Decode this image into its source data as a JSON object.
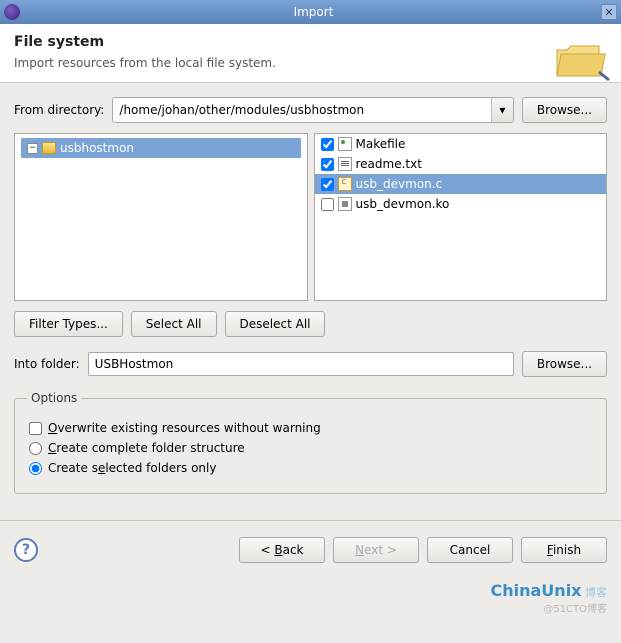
{
  "window": {
    "title": "Import"
  },
  "header": {
    "title": "File system",
    "desc": "Import resources from the local file system."
  },
  "fromdir": {
    "label": "From directory:",
    "value": "/home/johan/other/modules/usbhostmon",
    "browse": "Browse..."
  },
  "tree": {
    "root": "usbhostmon",
    "expanded": "−"
  },
  "files": [
    {
      "name": "Makefile",
      "checked": true,
      "selected": false,
      "ico": "mk"
    },
    {
      "name": "readme.txt",
      "checked": true,
      "selected": false,
      "ico": "txt"
    },
    {
      "name": "usb_devmon.c",
      "checked": true,
      "selected": true,
      "ico": "c"
    },
    {
      "name": "usb_devmon.ko",
      "checked": false,
      "selected": false,
      "ico": "ko"
    }
  ],
  "buttons": {
    "filter": "Filter Types...",
    "selall": "Select All",
    "deselall": "Deselect All"
  },
  "intofolder": {
    "label": "Into folder:",
    "value": "USBHostmon",
    "browse": "Browse..."
  },
  "options": {
    "legend": "Options",
    "overwrite": "Overwrite existing resources without warning",
    "complete": "Create complete folder structure",
    "selected": "Create selected folders only",
    "choice": "selected"
  },
  "nav": {
    "back": "< Back",
    "next": "Next >",
    "cancel": "Cancel",
    "finish": "Finish"
  },
  "watermark": {
    "brand": "ChinaUnix",
    "sub": "博客",
    "at": "@51CTO博客"
  }
}
